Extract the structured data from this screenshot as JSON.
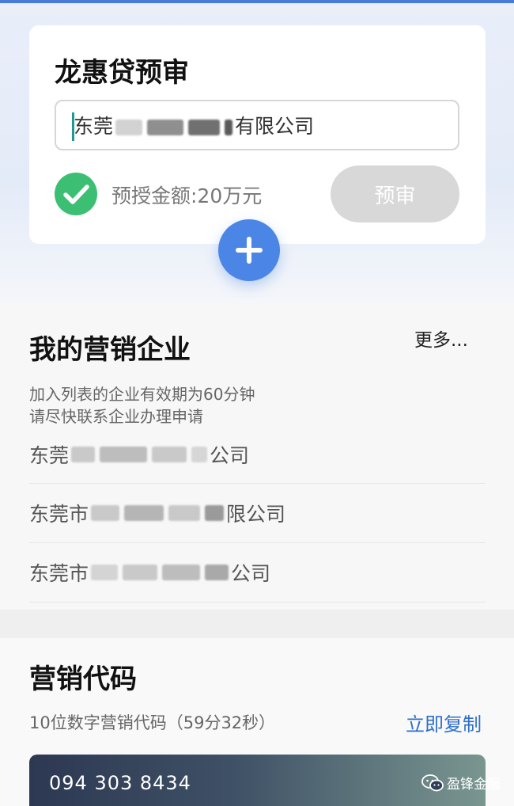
{
  "precheck": {
    "title": "龙惠贷预审",
    "company_prefix": "东莞",
    "company_suffix": "有限公司",
    "amount_text": "预授金额:20万元",
    "review_button": "预审"
  },
  "marketing": {
    "title": "我的营销企业",
    "more": "更多...",
    "hint_line1": "加入列表的企业有效期为60分钟",
    "hint_line2": "请尽快联系企业办理申请",
    "companies": [
      {
        "prefix": "东莞",
        "suffix": "公司"
      },
      {
        "prefix": "东莞市",
        "suffix": "限公司"
      },
      {
        "prefix": "东莞市",
        "suffix": "公司"
      }
    ]
  },
  "marketing_code": {
    "title": "营销代码",
    "description": "10位数字营销代码（59分32秒）",
    "copy_link": "立即复制",
    "code": "094 303 8434"
  },
  "watermark": {
    "text": "盈锋金服",
    "icon": "wechat-icon"
  },
  "colors": {
    "accent_blue": "#4b86e6",
    "success_green": "#3dbf73",
    "link_blue": "#2f6fc8",
    "disabled_button": "#d8d8d8"
  }
}
